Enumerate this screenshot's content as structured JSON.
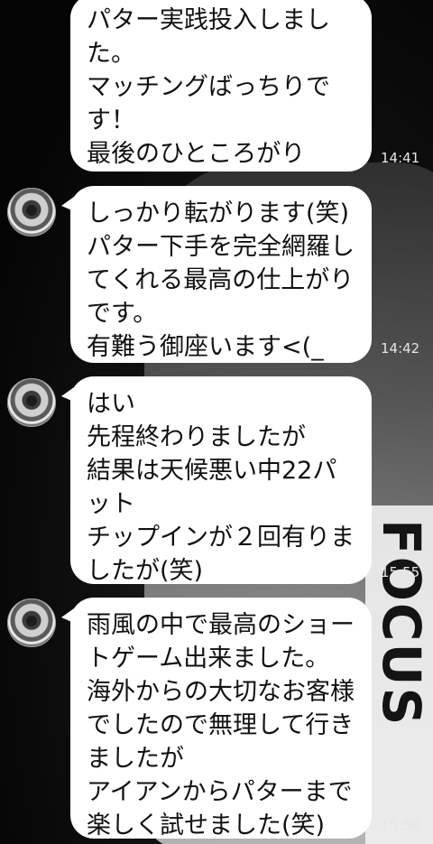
{
  "messages": [
    {
      "text": "パター実践投入しました。\nマッチングばっちりです！\n最後のひところがり",
      "time": "14:41",
      "has_avatar": false
    },
    {
      "text": "しっかり転がります(笑)\nパター下手を完全網羅してくれる最高の仕上がりです。\n有難う御座います<(_ _)>",
      "time": "14:42",
      "has_avatar": true
    },
    {
      "text": "はい\n先程終わりましたが\n結果は天候悪い中22パット\nチップインが２回有りましたが(笑)",
      "time": "15:55",
      "has_avatar": true
    },
    {
      "text": "雨風の中で最高のショートゲーム出来ました。\n海外からの大切なお客様でしたので無理して行きましたが\nアイアンからパターまで楽しく試せました(笑)",
      "time": "15:58",
      "has_avatar": true
    }
  ],
  "wallpaper": {
    "bag_text": "FOCUS"
  },
  "colors": {
    "bubble": "#ffffff",
    "background": "#0b0b0b",
    "time_text": "#e6e6e6"
  }
}
